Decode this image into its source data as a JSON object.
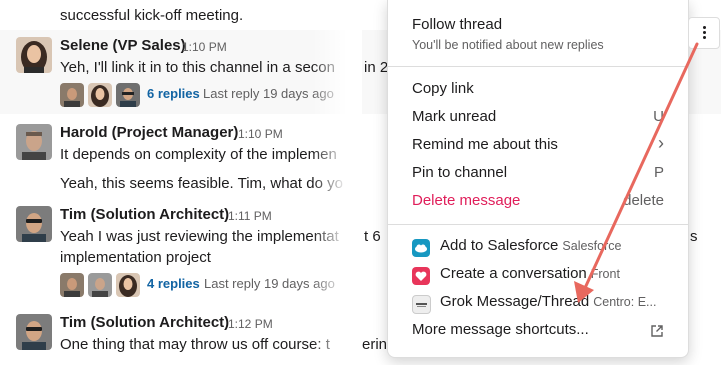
{
  "feed": {
    "top_partial_text": "successful kick-off meeting.",
    "messages": [
      {
        "author": "Selene (VP Sales)",
        "time": "1:10 PM",
        "lines": [
          "Yeh, I'll link it in to this channel in a secon",
          "in 2"
        ],
        "replies_count": "6 replies",
        "last_reply": "Last reply 19 days ago"
      },
      {
        "author": "Harold (Project Manager)",
        "time": "1:10 PM",
        "lines": [
          "It depends on complexity of the implemen",
          "Yeah, this seems feasible. Tim, what do yo"
        ]
      },
      {
        "author": "Tim (Solution Architect)",
        "time": "1:11 PM",
        "lines": [
          "Yeah I was just reviewing the implementat",
          "implementation project"
        ],
        "ghost_left": "t 6",
        "ghost_right": "s",
        "replies_count": "4 replies",
        "last_reply": "Last reply 19 days ago"
      },
      {
        "author": "Tim (Solution Architect)",
        "time": "1:12 PM",
        "lines": [
          "One thing that may throw us off course: t"
        ],
        "ghost_left": "erin"
      }
    ]
  },
  "menu": {
    "follow_label": "Follow thread",
    "follow_sub": "You'll be notified about new replies",
    "items": [
      {
        "label": "Copy link",
        "shortcut": ""
      },
      {
        "label": "Mark unread",
        "shortcut": "U"
      },
      {
        "label": "Remind me about this",
        "shortcut": "›"
      },
      {
        "label": "Pin to channel",
        "shortcut": "P"
      },
      {
        "label": "Delete message",
        "shortcut": "delete"
      }
    ],
    "apps": [
      {
        "label": "Add to Salesforce",
        "source": "Salesforce",
        "icon": "salesforce-icon",
        "color": "#1798c1"
      },
      {
        "label": "Create a conversation",
        "source": "Front",
        "icon": "front-icon",
        "color": "#e8355a"
      },
      {
        "label": "Grok Message/Thread",
        "source": "Centro: E...",
        "icon": "centro-icon",
        "color": "#eeeeee"
      }
    ],
    "more_label": "More message shortcuts...",
    "more_icon": "external-link-icon"
  },
  "colors": {
    "link_blue": "#1264a3",
    "danger_red": "#e01e5a",
    "annotation_arrow": "#e8685e"
  }
}
